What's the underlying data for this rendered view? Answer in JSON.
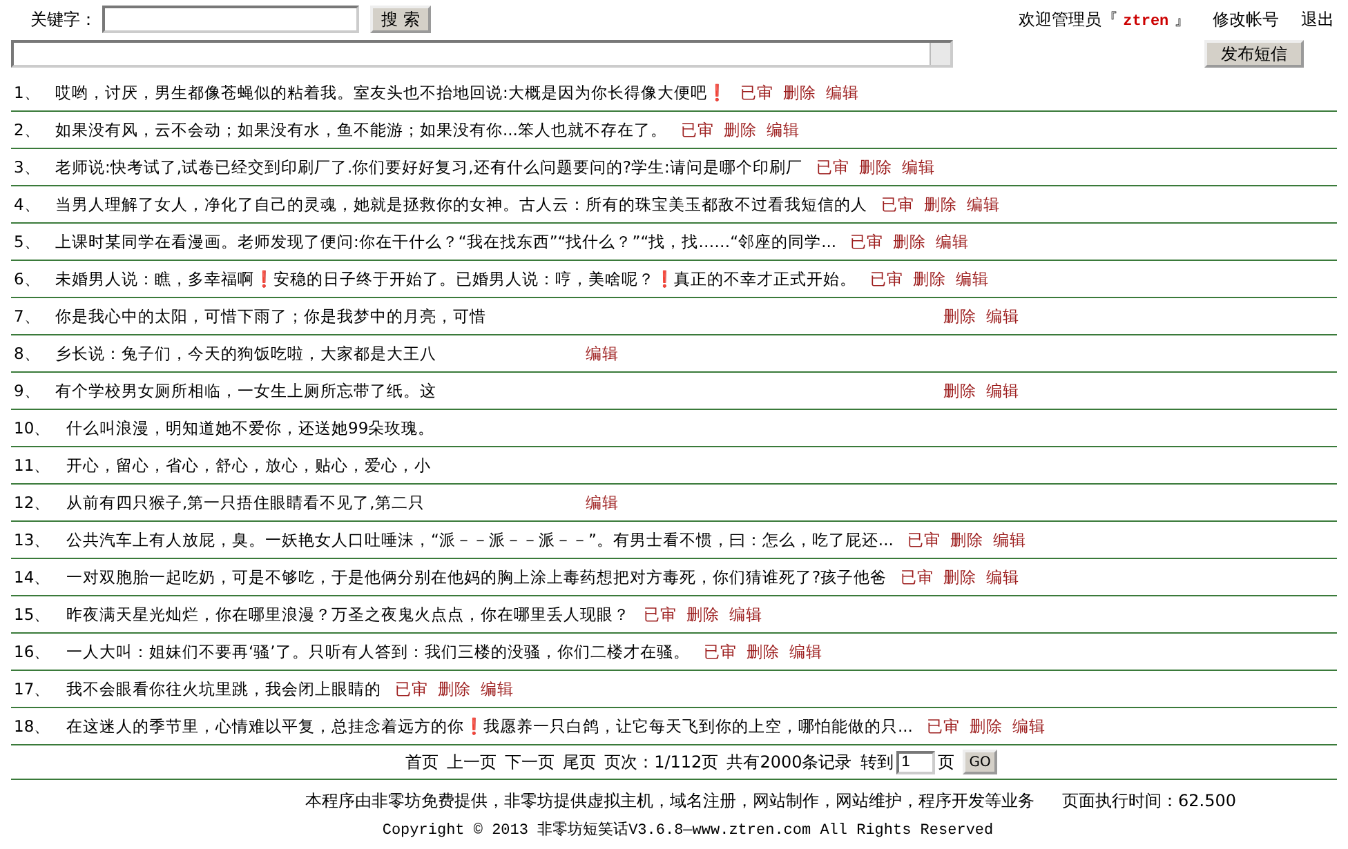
{
  "search": {
    "label": "关键字：",
    "button": "搜 索"
  },
  "account": {
    "welcome": "欢迎管理员『",
    "user": "ztren",
    "close": "』",
    "links": [
      "修改帐号",
      "退出"
    ]
  },
  "compose": {
    "button": "发布短信"
  },
  "rows": [
    {
      "number": "1、",
      "text": "哎哟，讨厌，男生都像苍蝇似的粘着我。室友头也不抬地回说:大概是因为你长得像大便吧❗",
      "actions": [
        "已审",
        "删除",
        "编辑"
      ]
    },
    {
      "number": "2、",
      "text": "如果没有风，云不会动；如果没有水，鱼不能游；如果没有你...笨人也就不存在了。",
      "actions": [
        "已审",
        "删除",
        "编辑"
      ]
    },
    {
      "number": "3、",
      "text": "老师说:快考试了,试卷已经交到印刷厂了.你们要好好复习,还有什么问题要问的?学生:请问是哪个印刷厂",
      "actions": [
        "已审",
        "删除",
        "编辑"
      ]
    },
    {
      "number": "4、",
      "text": "当男人理解了女人，净化了自己的灵魂，她就是拯救你的女神。古人云：所有的珠宝美玉都敌不过看我短信的人",
      "actions": [
        "已审",
        "删除",
        "编辑"
      ]
    },
    {
      "number": "5、",
      "text": "上课时某同学在看漫画。老师发现了便问:你在干什么？“我在找东西”“找什么？”“找，找……“邻座的同学...",
      "actions": [
        "已审",
        "删除",
        "编辑"
      ]
    },
    {
      "number": "6、",
      "text": "未婚男人说：瞧，多幸福啊❗安稳的日子终于开始了。已婚男人说：哼，美啥呢？❗真正的不幸才正式开始。",
      "actions": [
        "已审",
        "删除",
        "编辑"
      ]
    },
    {
      "number": "7、",
      "text": "你是我心中的太阳，可惜下雨了；你是我梦中的月亮，可惜",
      "actions": [
        "删除",
        "编辑"
      ]
    },
    {
      "number": "8、",
      "text": "乡长说：兔子们，今天的狗饭吃啦，大家都是大王八",
      "actions": [
        "编辑"
      ]
    },
    {
      "number": "9、",
      "text": "有个学校男女厕所相临，一女生上厕所忘带了纸。这",
      "actions": [
        "删除",
        "编辑"
      ]
    },
    {
      "number": "10、",
      "text": "什么叫浪漫，明知道她不爱你，还送她99朵玫瑰。",
      "actions": []
    },
    {
      "number": "11、",
      "text": "开心，留心，省心，舒心，放心，贴心，爱心，小",
      "actions": []
    },
    {
      "number": "12、",
      "text": "从前有四只猴子,第一只捂住眼睛看不见了,第二只",
      "actions": [
        "编辑"
      ]
    },
    {
      "number": "13、",
      "text": "公共汽车上有人放屁，臭。一妖艳女人口吐唾沫，“派－－派－－派－－”。有男士看不惯，曰：怎么，吃了屁还...",
      "actions": [
        "已审",
        "删除",
        "编辑"
      ]
    },
    {
      "number": "14、",
      "text": "一对双胞胎一起吃奶，可是不够吃，于是他俩分别在他妈的胸上涂上毒药想把对方毒死，你们猜谁死了?孩子他爸",
      "actions": [
        "已审",
        "删除",
        "编辑"
      ]
    },
    {
      "number": "15、",
      "text": "昨夜满天星光灿烂，你在哪里浪漫？万圣之夜鬼火点点，你在哪里丢人现眼？",
      "actions": [
        "已审",
        "删除",
        "编辑"
      ]
    },
    {
      "number": "16、",
      "text": "一人大叫：姐妹们不要再‘骚’了。只听有人答到：我们三楼的没骚，你们二楼才在骚。",
      "actions": [
        "已审",
        "删除",
        "编辑"
      ]
    },
    {
      "number": "17、",
      "text": "我不会眼看你往火坑里跳，我会闭上眼睛的",
      "actions": [
        "已审",
        "删除",
        "编辑"
      ]
    },
    {
      "number": "18、",
      "text": "在这迷人的季节里，心情难以平复，总挂念着远方的你❗我愿养一只白鸽，让它每天飞到你的上空，哪怕能做的只...",
      "actions": [
        "已审",
        "删除",
        "编辑"
      ]
    }
  ],
  "pager": {
    "links": [
      "首页",
      "上一页",
      "下一页",
      "尾页"
    ],
    "page_info": "页次：1/112页",
    "total": "共有2000条记录",
    "goto": "转到",
    "goto_value": "1",
    "page_unit": "页",
    "go": "GO"
  },
  "footer": {
    "services": "本程序由非零坊免费提供，非零坊提供虚拟主机，域名注册，网站制作，网站维护，程序开发等业务",
    "exec_time": "页面执行时间：62.500",
    "copyright": "Copyright © 2013 非零坊短笑话V3.6.8—www.ztren.com All Rights Reserved"
  }
}
